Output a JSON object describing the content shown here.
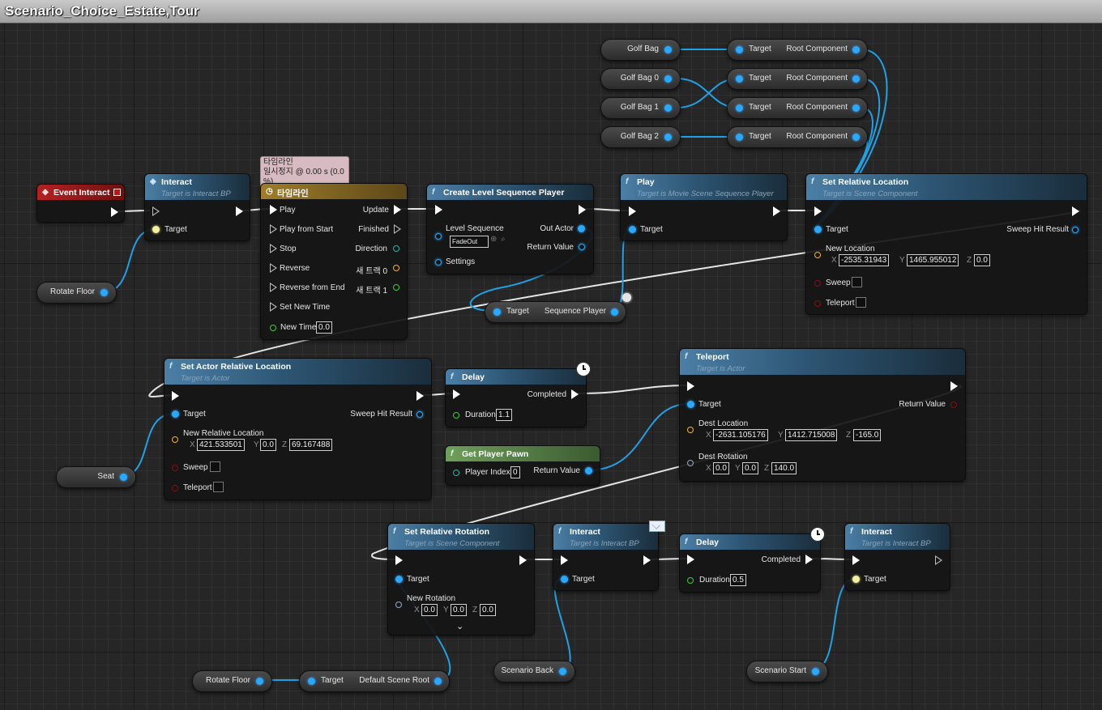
{
  "title": "Scenario_Choice_Estate,Tour",
  "vars": {
    "golf_bag": "Golf Bag",
    "golf_bag0": "Golf Bag 0",
    "golf_bag1": "Golf Bag 1",
    "golf_bag2": "Golf Bag 2",
    "rotate_floor": "Rotate Floor",
    "seat": "Seat",
    "scenario_back": "Scenario Back",
    "scenario_start": "Scenario Start",
    "rotate_floor2": "Rotate Floor"
  },
  "getroot": {
    "target": "Target",
    "out": "Root Component"
  },
  "event": {
    "title": "Event Interact"
  },
  "interact1": {
    "title": "Interact",
    "sub": "Target is Interact BP",
    "target": "Target"
  },
  "timeline": {
    "title": "타임라인",
    "bubble1": "타임라인",
    "bubble2": "일시정지 @ 0.00 s (0.0 %)",
    "play": "Play",
    "play_start": "Play from Start",
    "stop": "Stop",
    "reverse": "Reverse",
    "reverse_end": "Reverse from End",
    "set_new_time": "Set New Time",
    "new_time": "New Time",
    "new_time_val": "0.0",
    "update": "Update",
    "finished": "Finished",
    "direction": "Direction",
    "track0": "새 트랙 0",
    "track1": "새 트랙 1"
  },
  "clsp": {
    "title": "Create Level Sequence Player",
    "level_seq": "Level Sequence",
    "seq_val": "FadeOut",
    "settings": "Settings",
    "out_actor": "Out Actor",
    "ret": "Return Value"
  },
  "play": {
    "title": "Play",
    "sub": "Target is Movie Scene Sequence Player",
    "target": "Target"
  },
  "seqplayer": {
    "target": "Target",
    "out": "Sequence Player"
  },
  "srl": {
    "title": "Set Relative Location",
    "sub": "Target is Scene Component",
    "target": "Target",
    "new_loc": "New Location",
    "x": "-2535.31943",
    "y": "1465.955012",
    "z": "0.0",
    "sweep": "Sweep",
    "teleport": "Teleport",
    "sweep_hit": "Sweep Hit Result"
  },
  "sarl": {
    "title": "Set Actor Relative Location",
    "sub": "Target is Actor",
    "target": "Target",
    "new_loc": "New Relative Location",
    "x": "421.533501",
    "y": "0.0",
    "z": "69.167488",
    "sweep": "Sweep",
    "teleport": "Teleport",
    "sweep_hit": "Sweep Hit Result"
  },
  "delay1": {
    "title": "Delay",
    "completed": "Completed",
    "duration": "Duration",
    "dur_val": "1.1"
  },
  "gpp": {
    "title": "Get Player Pawn",
    "player_index": "Player Index",
    "pi_val": "0",
    "ret": "Return Value"
  },
  "teleport": {
    "title": "Teleport",
    "sub": "Target is Actor",
    "target": "Target",
    "dest_loc": "Dest Location",
    "x": "-2631.105176",
    "y": "1412.715008",
    "z": "-165.0",
    "dest_rot": "Dest Rotation",
    "rx": "0.0",
    "ry": "0.0",
    "rz": "140.0",
    "ret": "Return Value"
  },
  "srr": {
    "title": "Set Relative Rotation",
    "sub": "Target is Scene Component",
    "target": "Target",
    "new_rot": "New Rotation",
    "x": "0.0",
    "y": "0.0",
    "z": "0.0"
  },
  "interact2": {
    "title": "Interact",
    "sub": "Target is Interact BP",
    "target": "Target"
  },
  "delay2": {
    "title": "Delay",
    "completed": "Completed",
    "duration": "Duration",
    "dur_val": "0.5"
  },
  "interact3": {
    "title": "Interact",
    "sub": "Target is Interact BP",
    "target": "Target"
  },
  "dsr": {
    "target": "Target",
    "out": "Default Scene Root"
  },
  "axes": {
    "x": "X",
    "y": "Y",
    "z": "Z"
  }
}
